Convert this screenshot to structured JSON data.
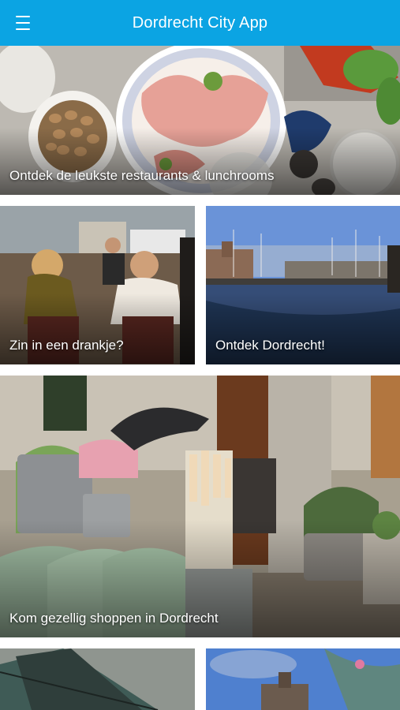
{
  "header": {
    "title": "Dordrecht City App",
    "menu_icon": "hamburger-menu-icon",
    "background_color": "#0ba4e3"
  },
  "tiles": [
    {
      "caption": "Ontdek de leukste restaurants & lunchrooms"
    },
    {
      "caption": "Zin in een drankje?"
    },
    {
      "caption": "Ontdek Dordrecht!"
    },
    {
      "caption": "Kom gezellig shoppen in Dordrecht"
    },
    {
      "caption": ""
    },
    {
      "caption": ""
    }
  ]
}
